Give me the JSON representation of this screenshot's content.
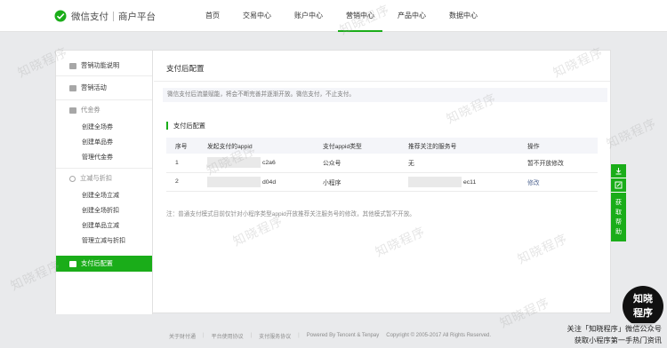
{
  "brand": {
    "name": "微信支付",
    "subtitle": "商户平台",
    "color": "#1aad19"
  },
  "nav": {
    "items": [
      {
        "label": "首页"
      },
      {
        "label": "交易中心"
      },
      {
        "label": "账户中心"
      },
      {
        "label": "营销中心"
      },
      {
        "label": "产品中心"
      },
      {
        "label": "数据中心"
      }
    ],
    "active": "营销中心"
  },
  "sidebar": {
    "intro": "营销功能说明",
    "activity": "营销活动",
    "coupon_group": "代金券",
    "coupon_items": [
      {
        "label": "创建全场券"
      },
      {
        "label": "创建单品券"
      },
      {
        "label": "管理代金券"
      }
    ],
    "discount_group": "立减与折扣",
    "discount_items": [
      {
        "label": "创建全场立减"
      },
      {
        "label": "创建全场折扣"
      },
      {
        "label": "创建单品立减"
      },
      {
        "label": "管理立减与折扣"
      }
    ],
    "active_item": "支付后配置"
  },
  "main": {
    "title": "支付后配置",
    "notice": "微信支付后流量赋能，将会不断完善并逐渐开放。微信支付，不止支付。",
    "section_title": "支付后配置",
    "table": {
      "headers": [
        "序号",
        "发起支付的appid",
        "支付appid类型",
        "推荐关注的服务号",
        "操作"
      ],
      "rows": [
        {
          "index": "1",
          "appid_suffix": "c2a6",
          "type": "公众号",
          "service_prefix": "",
          "service_suffix": "无",
          "action": "暂不开放修改"
        },
        {
          "index": "2",
          "appid_suffix": "d04d",
          "type": "小程序",
          "service_prefix": "",
          "service_suffix": "ec11",
          "action": "修改"
        }
      ]
    },
    "note": "注：普通支付模式目前仅针对小程序类型appid开放推荐关注服务号的修改，其他模式暂不开放。"
  },
  "tools": {
    "help_label": "获取帮助"
  },
  "footer": {
    "links": [
      "关于财付通",
      "平台使用协议",
      "支付服务协议",
      "Powered By Tencent & Tenpay"
    ],
    "copyright": "Copyright © 2005-2017 All Rights Reserved."
  },
  "watermark": {
    "badge_line1": "知晓",
    "badge_line2": "程序",
    "caption_line1": "关注「知晓程序」微信公众号",
    "caption_line2": "获取小程序第一手热门资讯",
    "text": "知晓程序"
  }
}
